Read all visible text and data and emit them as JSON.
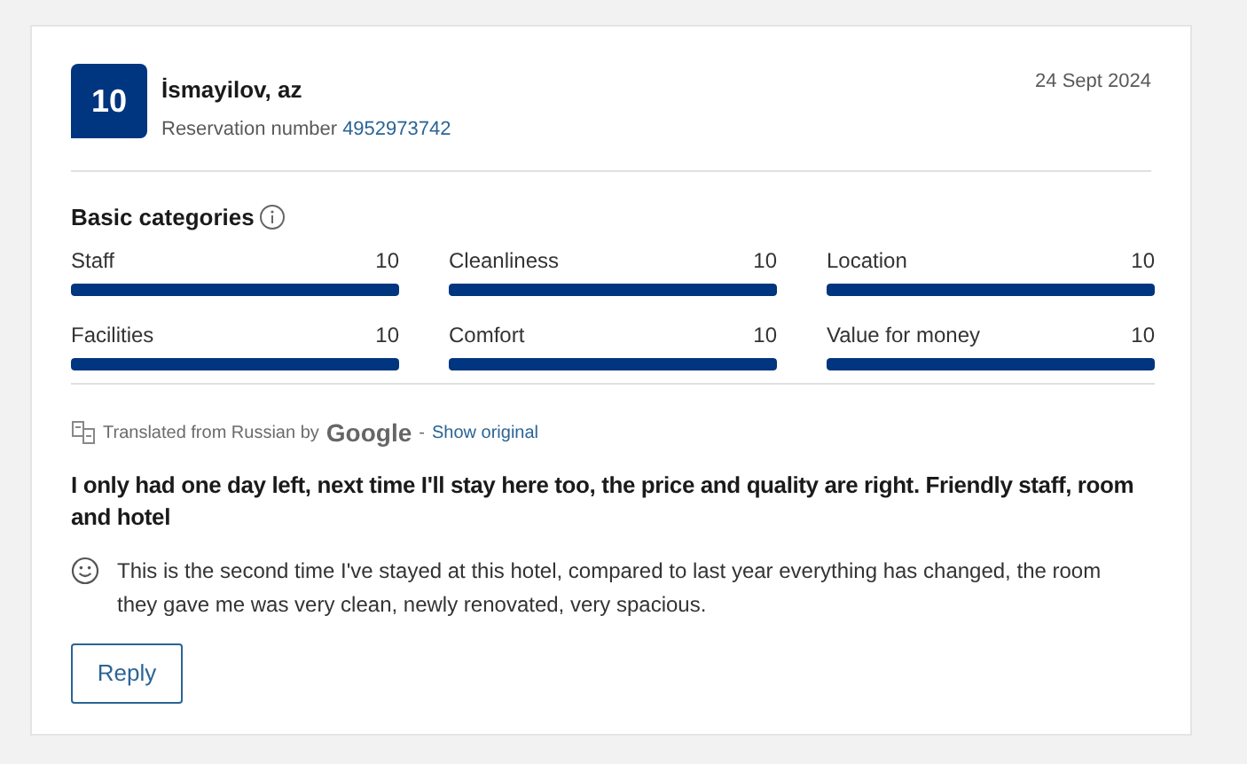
{
  "review": {
    "score": "10",
    "name": "İsmayilov, az",
    "reservation_label": "Reservation number",
    "reservation_number": "4952973742",
    "date": "24 Sept 2024",
    "categories_title": "Basic categories",
    "categories": [
      {
        "name": "Staff",
        "score": "10",
        "level": 1
      },
      {
        "name": "Cleanliness",
        "score": "10",
        "level": 1
      },
      {
        "name": "Location",
        "score": "10",
        "level": 1
      },
      {
        "name": "Facilities",
        "score": "10",
        "level": 1
      },
      {
        "name": "Comfort",
        "score": "10",
        "level": 1
      },
      {
        "name": "Value for money",
        "score": "10",
        "level": 1
      }
    ],
    "translation": {
      "text": "Translated from Russian by",
      "provider": "Google",
      "separator": "-",
      "link": "Show original"
    },
    "headline": "I only had one day left, next time I'll stay here too, the price and quality are right. Friendly staff, room and hotel",
    "positive": "This is the second time I've stayed at this hotel, compared to last year everything has changed, the room they gave me was very clean, newly renovated, very spacious.",
    "reply_button": "Reply"
  }
}
